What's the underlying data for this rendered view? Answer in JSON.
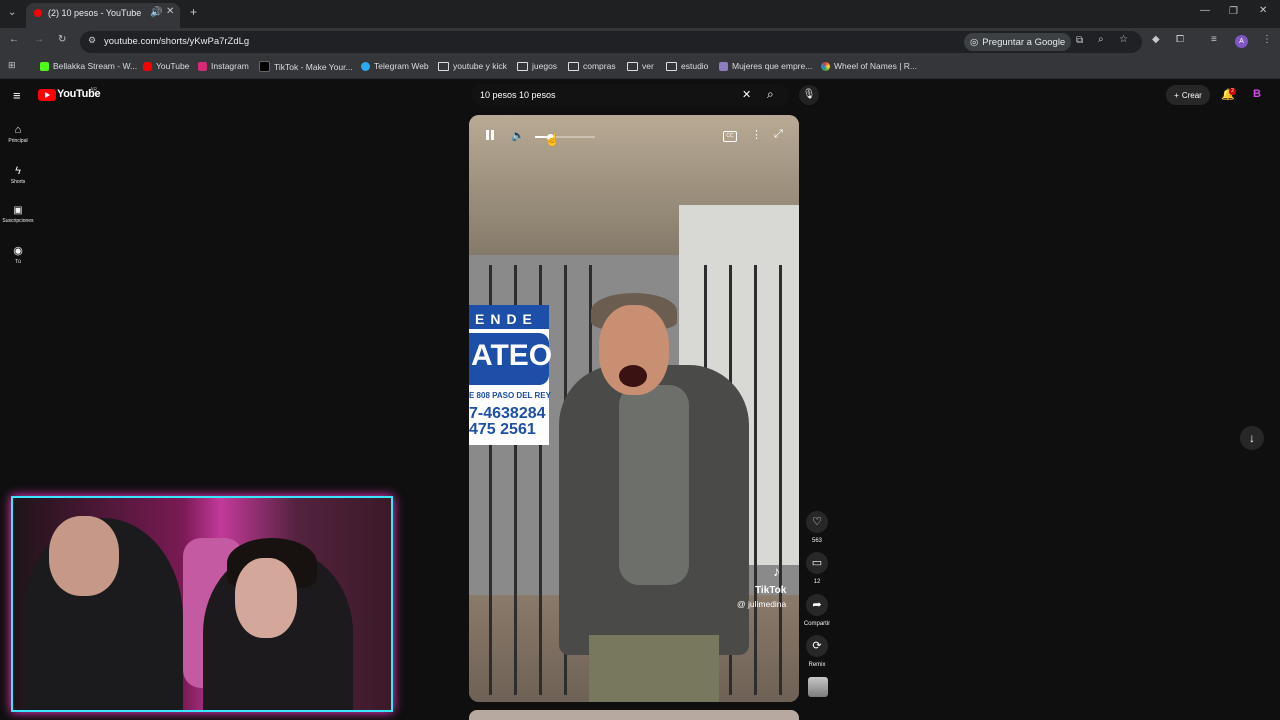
{
  "browser": {
    "tab_title": "(2) 10 pesos - YouTube",
    "url": "youtube.com/shorts/yKwPa7rZdLg",
    "ask_google": "Preguntar a Google",
    "bookmarks": [
      "Bellakka Stream - W...",
      "YouTube",
      "Instagram",
      "TikTok - Make Your...",
      "Telegram Web",
      "youtube y kick",
      "juegos",
      "compras",
      "ver",
      "estudio",
      "Mujeres que empre...",
      "Wheel of Names | R..."
    ]
  },
  "youtube": {
    "logo": "YouTube",
    "country": "AR",
    "search_value": "10 pesos 10 pesos",
    "create_label": "Crear",
    "notifications_count": "2",
    "sidebar": [
      "Principal",
      "Shorts",
      "Suscripciones",
      "Tú"
    ]
  },
  "video": {
    "volume_level": 0.2,
    "sign": {
      "line1": "ENDE",
      "line2": "ATEO",
      "line3": "E 808 PASO DEL REY",
      "line4": "7-4638284",
      "line5": "475 2561"
    },
    "watermark": {
      "brand": "TikTok",
      "handle": "@ julimedina"
    }
  },
  "actions": {
    "likes": "563",
    "comments": "12",
    "share": "Compartir",
    "remix": "Remix"
  },
  "colors": {
    "youtube_red": "#ff0000",
    "webcam_border_cyan": "#38e6ff",
    "webcam_glow_pink": "#ff3bd4"
  }
}
